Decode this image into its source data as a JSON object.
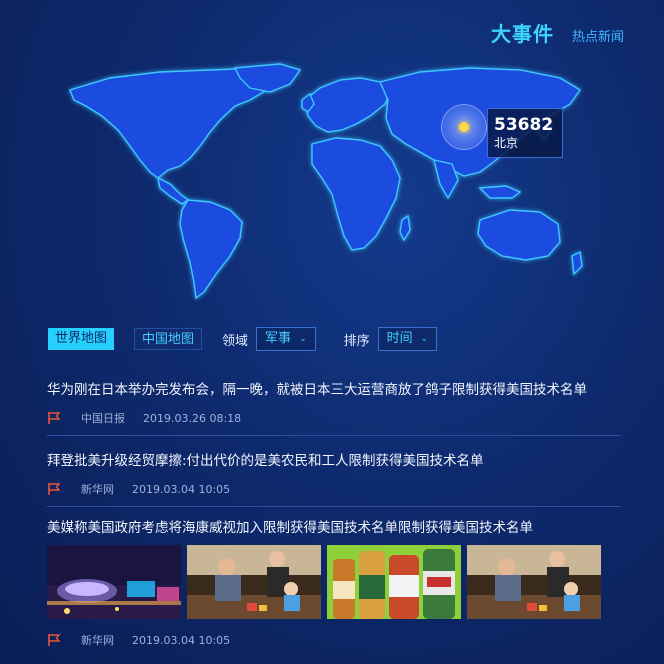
{
  "header": {
    "title": "大事件",
    "subtitle": "热点新闻"
  },
  "map": {
    "marker": {
      "value": "53682",
      "city": "北京"
    },
    "colors": {
      "land": "#1f4be0",
      "outline": "#3ec8ff",
      "marker": "#ffd84a"
    }
  },
  "controls": {
    "tab_world": "世界地图",
    "tab_china": "中国地图",
    "field_label": "领域",
    "field_value": "军事",
    "sort_label": "排序",
    "sort_value": "时间"
  },
  "news": [
    {
      "title": "华为刚在日本举办完发布会，隔一晚，就被日本三大运营商放了鸽子限制获得美国技术名单",
      "source": "中国日报",
      "time": "2019.03.26 08:18"
    },
    {
      "title": "拜登批美升级经贸摩擦:付出代价的是美农民和工人限制获得美国技术名单",
      "source": "新华网",
      "time": "2019.03.04 10:05"
    },
    {
      "title": "美媒称美国政府考虑将海康威视加入限制获得美国技术名单限制获得美国技术名单",
      "source": "新华网",
      "time": "2019.03.04 10:05"
    }
  ],
  "images": [
    {
      "name": "stadium-night-image"
    },
    {
      "name": "family-playing-image"
    },
    {
      "name": "beer-bottles-image"
    },
    {
      "name": "family-playing-image-2"
    }
  ]
}
